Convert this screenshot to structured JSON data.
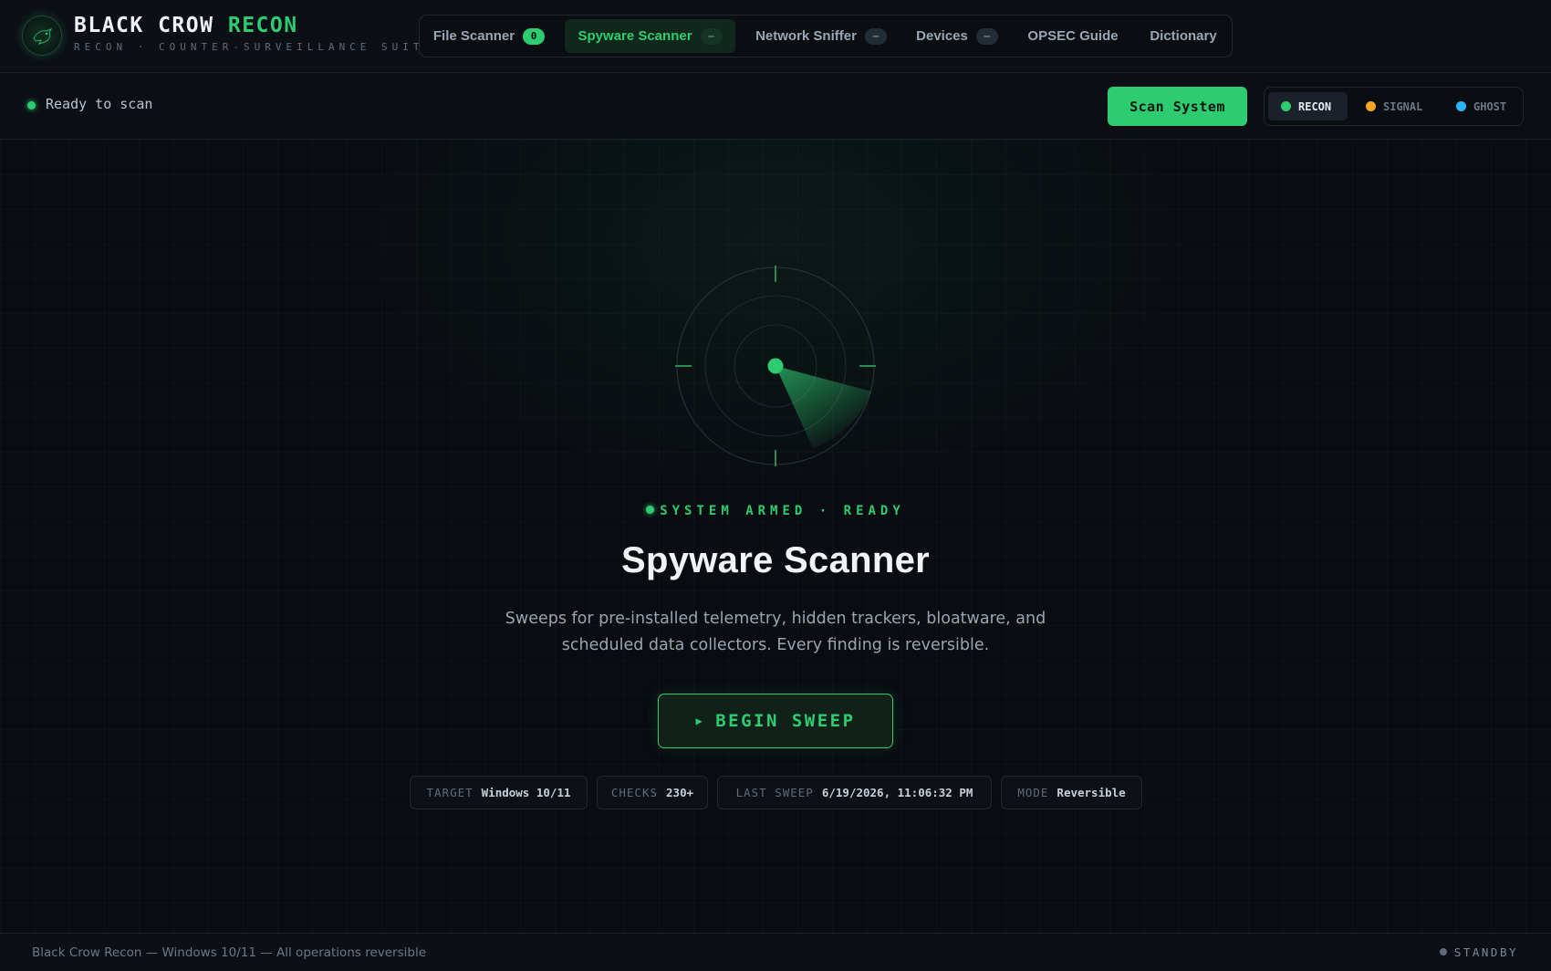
{
  "app": {
    "brand_main": "BLACK CROW",
    "brand_accent": "RECON",
    "tagline": "RECON · COUNTER-SURVEILLANCE SUITE",
    "logo_icon": "crow-icon"
  },
  "nav": {
    "tabs": [
      {
        "label": "File Scanner",
        "badge": "0",
        "active": false
      },
      {
        "label": "Spyware Scanner",
        "badge": "–",
        "active": true
      },
      {
        "label": "Network Sniffer",
        "badge": "–",
        "active": false
      },
      {
        "label": "Devices",
        "badge": "–",
        "active": false
      },
      {
        "label": "OPSEC Guide",
        "active": false
      },
      {
        "label": "Dictionary",
        "active": false
      }
    ]
  },
  "toolbar": {
    "status": "Ready to scan",
    "scan_button": "Scan System",
    "themes": [
      {
        "label": "RECON",
        "color": "#2ecc71",
        "active": true
      },
      {
        "label": "SIGNAL",
        "color": "#f5a623",
        "active": false
      },
      {
        "label": "GHOST",
        "color": "#29b6f6",
        "active": false
      }
    ]
  },
  "main": {
    "radar_icon": "radar-icon",
    "armed_status": "SYSTEM ARMED · READY",
    "title": "Spyware Scanner",
    "description": "Sweeps for pre-installed telemetry, hidden trackers, bloatware, and scheduled data collectors. Every finding is reversible.",
    "sweep_button": "BEGIN SWEEP",
    "chips": [
      {
        "key": "TARGET",
        "value": "Windows 10/11"
      },
      {
        "key": "CHECKS",
        "value": "230+"
      },
      {
        "key": "LAST SWEEP",
        "value": "6/19/2026, 11:06:32 PM"
      },
      {
        "key": "MODE",
        "value": "Reversible"
      }
    ]
  },
  "footer": {
    "text": "Black Crow Recon — Windows 10/11 — All operations reversible",
    "state": "STANDBY"
  },
  "colors": {
    "accent": "#2ecc71",
    "background": "#0a0d12"
  }
}
